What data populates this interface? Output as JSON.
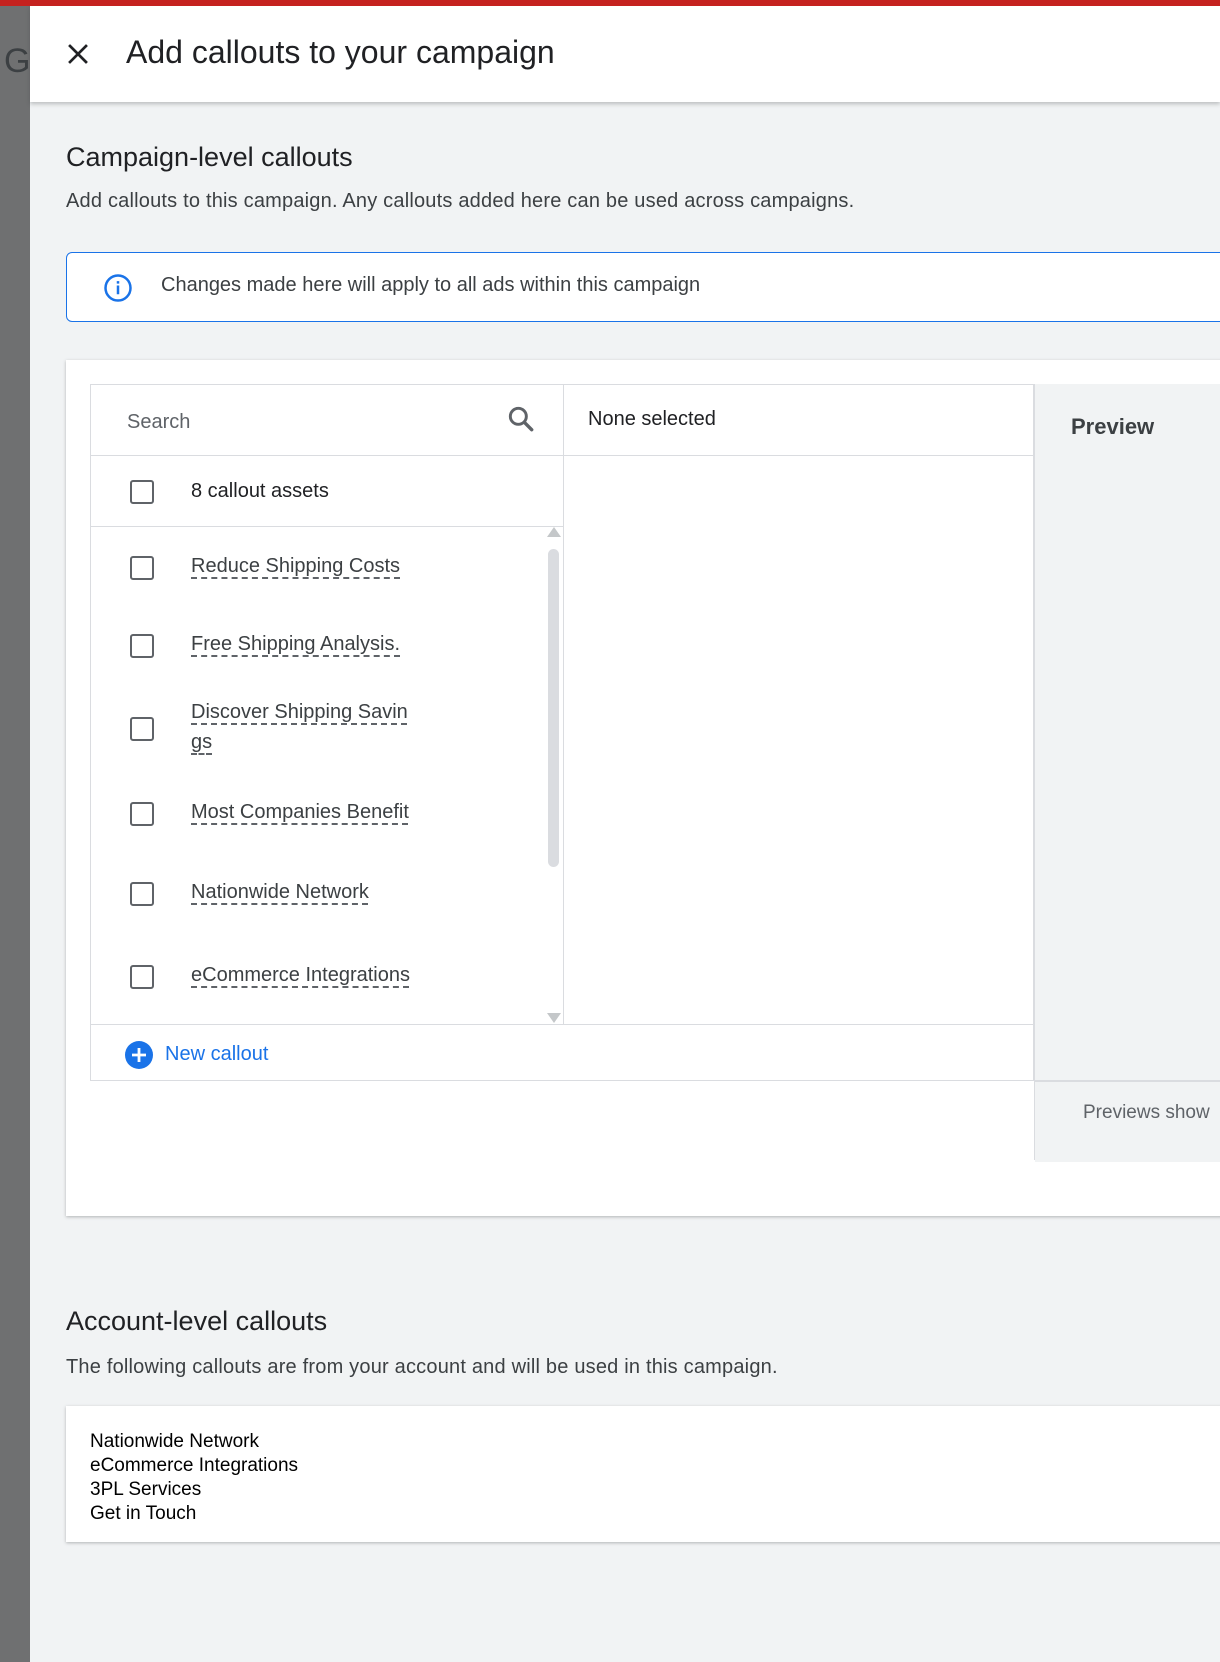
{
  "header": {
    "title": "Add callouts to your campaign",
    "background_letter": "G"
  },
  "campaign_section": {
    "title": "Campaign-level callouts",
    "description": "Add callouts to this campaign. Any callouts added here can be used across campaigns.",
    "info_banner": "Changes made here will apply to all ads within this campaign"
  },
  "picker": {
    "search_placeholder": "Search",
    "select_all_label": "8 callout assets",
    "selected_status": "None selected",
    "items": [
      {
        "label": "Reduce Shipping Costs",
        "checked": false
      },
      {
        "label": "Free Shipping Analysis.",
        "checked": false
      },
      {
        "label": "Discover Shipping Savin gs",
        "checked": false
      },
      {
        "label": "Most Companies Benefit",
        "checked": false
      },
      {
        "label": "Nationwide Network",
        "checked": false
      },
      {
        "label": "eCommerce Integrations",
        "checked": false
      }
    ],
    "new_callout_label": "New callout"
  },
  "preview": {
    "title": "Preview",
    "note": "Previews show"
  },
  "account_section": {
    "title": "Account-level callouts",
    "description": "The following callouts are from your account and will be used in this campaign.",
    "items": [
      "Nationwide Network",
      "eCommerce Integrations",
      "3PL Services",
      "Get in Touch"
    ]
  },
  "colors": {
    "accent_red": "#c5221f",
    "primary_blue": "#1a73e8",
    "background": "#f1f3f4"
  },
  "icons": {
    "close": "close-icon",
    "info": "info-icon",
    "search": "search-icon",
    "add": "add-circle-icon"
  }
}
